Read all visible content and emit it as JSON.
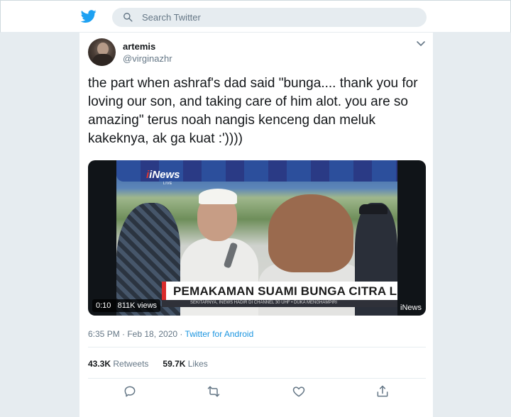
{
  "header": {
    "search_placeholder": "Search Twitter"
  },
  "tweet": {
    "author_name": "artemis",
    "author_handle": "@virginazhr",
    "text": "the part when ashraf's dad said \"bunga.... thank you for loving our son, and taking care of him alot. you are so amazing\" terus noah nangis kenceng dan meluk kakeknya, ak ga kuat :'))))",
    "media": {
      "channel_logo": "iNews",
      "channel_sub": "LIVE",
      "headline": "PEMAKAMAN SUAMI BUNGA CITRA LESTARI",
      "ticker": "SEKITARNYA, INEWS HADIR DI CHANNEL 30 UHF  •  DUKA MENGHAMPIRI",
      "corner_logo": "iNews",
      "duration": "0:10",
      "views": "811K views"
    },
    "timestamp": "6:35 PM · Feb 18, 2020",
    "separator": " · ",
    "source": "Twitter for Android",
    "stats": {
      "retweets_count": "43.3K",
      "retweets_label": "Retweets",
      "likes_count": "59.7K",
      "likes_label": "Likes"
    }
  },
  "colors": {
    "brand": "#1da1f2",
    "link": "#1b95e0",
    "secondary_text": "#657786",
    "primary_text": "#14171a"
  },
  "icons": [
    "twitter-bird-icon",
    "search-icon",
    "chevron-down-icon",
    "reply-icon",
    "retweet-icon",
    "like-icon",
    "share-icon"
  ]
}
